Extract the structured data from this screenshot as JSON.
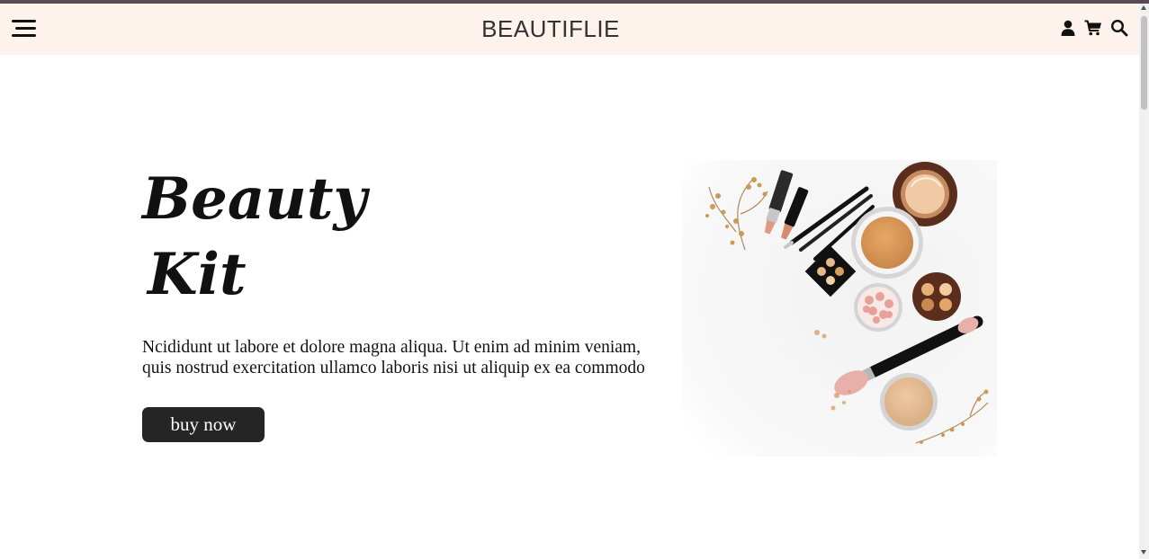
{
  "header": {
    "brand": "BEAUTIFLIE",
    "icons": [
      "menu-icon",
      "user-icon",
      "cart-icon",
      "search-icon"
    ]
  },
  "hero": {
    "title_line1": "Beauty",
    "title_line2": "Kit",
    "description": "Ncididunt ut labore et dolore magna aliqua. Ut enim ad minim veniam, quis nostrud exercitation ullamco laboris nisi ut aliquip ex ea commodo",
    "button_label": "buy now"
  },
  "colors": {
    "header_bg": "#fdf2ec",
    "top_stripe": "#5a4a55",
    "button_bg": "#252525",
    "text": "#111111"
  }
}
